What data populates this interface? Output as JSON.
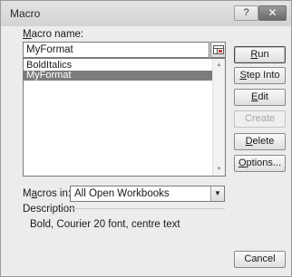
{
  "window": {
    "title": "Macro",
    "help_glyph": "?",
    "close_glyph": "✕"
  },
  "macro_name": {
    "label_underline": "M",
    "label_rest": "acro name:",
    "value": "MyFormat"
  },
  "macro_list": {
    "items": [
      {
        "label": "BoldItalics",
        "selected": false
      },
      {
        "label": "MyFormat",
        "selected": true
      }
    ]
  },
  "buttons": {
    "run": {
      "pre": "",
      "ul": "R",
      "post": "un"
    },
    "step_into": {
      "pre": "",
      "ul": "S",
      "post": "tep Into"
    },
    "edit": {
      "pre": "",
      "ul": "E",
      "post": "dit"
    },
    "create": {
      "label": "Create",
      "enabled": false
    },
    "delete": {
      "pre": "",
      "ul": "D",
      "post": "elete"
    },
    "options": {
      "pre": "",
      "ul": "O",
      "post": "ptions..."
    },
    "cancel": {
      "label": "Cancel"
    }
  },
  "macros_in": {
    "label_pre": "M",
    "label_ul": "a",
    "label_post": "cros in:",
    "value": "All Open Workbooks"
  },
  "description": {
    "label": "Description",
    "text": "Bold, Courier 20 font, centre text"
  }
}
